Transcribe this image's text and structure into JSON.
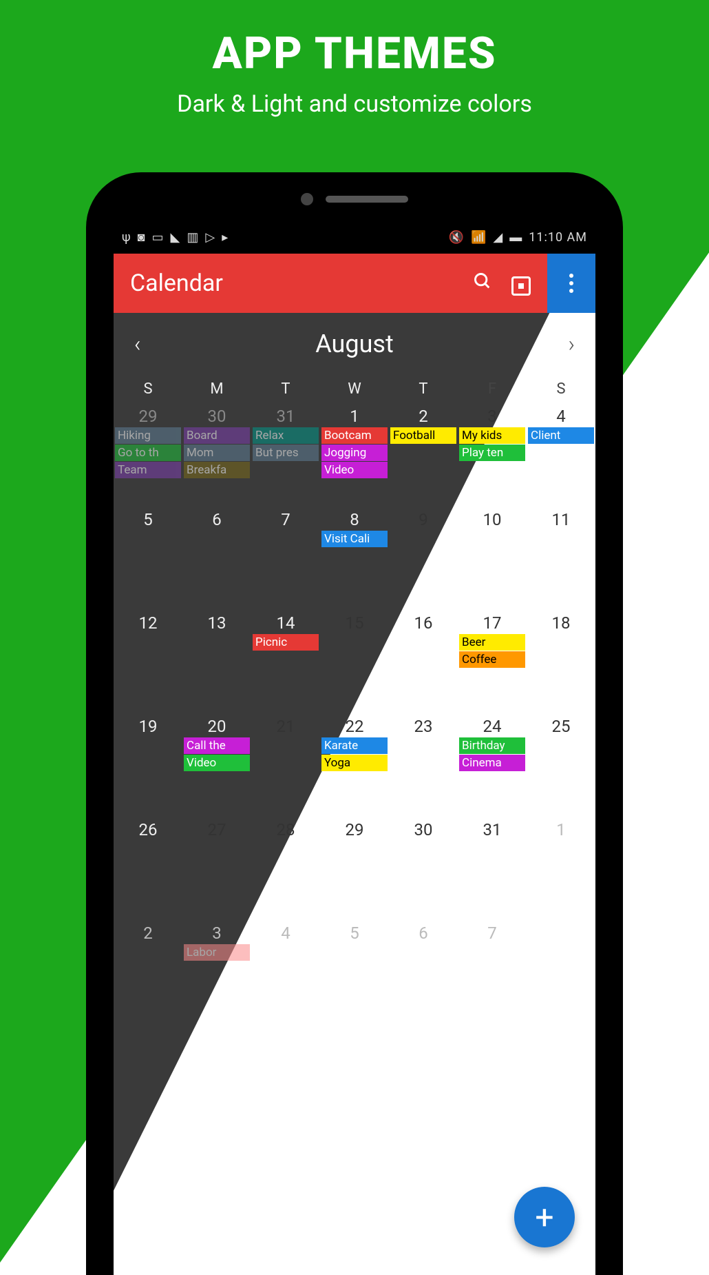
{
  "hero": {
    "title": "APP THEMES",
    "subtitle": "Dark & Light and customize colors"
  },
  "status": {
    "time": "11:10 AM"
  },
  "appbar": {
    "title": "Calendar"
  },
  "month": {
    "label": "August"
  },
  "dow": [
    "S",
    "M",
    "T",
    "W",
    "T",
    "F",
    "S"
  ],
  "colors": {
    "green": "#1ca81c",
    "red": "#e53935",
    "blue": "#1976d2",
    "magenta": "#c61fd6",
    "yellow": "#ffeb00",
    "lime": "#1fbf3a",
    "orange": "#ff9800",
    "teal": "#009688",
    "blue2": "#1e88e5",
    "pink": "#fb8a8a",
    "grayblue": "#5d7d93"
  },
  "weeks": [
    [
      {
        "num": "29",
        "mode": "dark prev",
        "events": [
          {
            "text": "Hiking",
            "bg": "#5d7d93",
            "dim": true
          },
          {
            "text": "Go to th",
            "bg": "#1fbf3a",
            "dim": true
          },
          {
            "text": "Team",
            "bg": "#7d3fae",
            "dim": true
          }
        ]
      },
      {
        "num": "30",
        "mode": "dark prev",
        "events": [
          {
            "text": "Board",
            "bg": "#7d3fae",
            "dim": true
          },
          {
            "text": "Mom",
            "bg": "#5d7d93",
            "dim": true
          },
          {
            "text": "Breakfa",
            "bg": "#7a6a1a",
            "dim": true
          }
        ]
      },
      {
        "num": "31",
        "mode": "dark prev",
        "events": [
          {
            "text": "Relax",
            "bg": "#009688",
            "dim": true
          },
          {
            "text": "But pres",
            "bg": "#5d7d93",
            "dim": true
          }
        ]
      },
      {
        "num": "1",
        "mode": "dark",
        "events": [
          {
            "text": "Bootcam",
            "bg": "#e53935"
          },
          {
            "text": "Jogging",
            "bg": "#c61fd6"
          },
          {
            "text": "Video",
            "bg": "#c61fd6"
          }
        ]
      },
      {
        "num": "2",
        "mode": "dark",
        "events": [
          {
            "text": "Football",
            "bg": "#ffeb00",
            "darktext": true
          }
        ]
      },
      {
        "num": "3",
        "mode": "light",
        "events": [
          {
            "text": "My kids",
            "bg": "#ffeb00",
            "darktext": true
          },
          {
            "text": "Play ten",
            "bg": "#1fbf3a"
          }
        ]
      },
      {
        "num": "4",
        "mode": "light",
        "events": [
          {
            "text": "Client",
            "bg": "#1e88e5"
          }
        ]
      }
    ],
    [
      {
        "num": "5",
        "mode": "dark",
        "events": []
      },
      {
        "num": "6",
        "mode": "dark",
        "events": []
      },
      {
        "num": "7",
        "mode": "dark",
        "events": []
      },
      {
        "num": "8",
        "mode": "dark",
        "events": [
          {
            "text": "Visit Cali",
            "bg": "#1e88e5"
          }
        ]
      },
      {
        "num": "9",
        "mode": "light",
        "events": []
      },
      {
        "num": "10",
        "mode": "light",
        "events": []
      },
      {
        "num": "11",
        "mode": "light",
        "events": []
      }
    ],
    [
      {
        "num": "12",
        "mode": "dark",
        "events": []
      },
      {
        "num": "13",
        "mode": "dark",
        "events": []
      },
      {
        "num": "14",
        "mode": "dark",
        "events": [
          {
            "text": "Picnic",
            "bg": "#e53935"
          }
        ]
      },
      {
        "num": "15",
        "mode": "light",
        "events": []
      },
      {
        "num": "16",
        "mode": "light",
        "events": []
      },
      {
        "num": "17",
        "mode": "light",
        "events": [
          {
            "text": "Beer",
            "bg": "#ffeb00",
            "darktext": true
          },
          {
            "text": "Coffee",
            "bg": "#ff9800",
            "darktext": true
          }
        ]
      },
      {
        "num": "18",
        "mode": "light",
        "events": []
      }
    ],
    [
      {
        "num": "19",
        "mode": "dark",
        "events": []
      },
      {
        "num": "20",
        "mode": "dark",
        "events": [
          {
            "text": "Call the",
            "bg": "#c61fd6"
          },
          {
            "text": "Video",
            "bg": "#1fbf3a"
          }
        ]
      },
      {
        "num": "21",
        "mode": "light",
        "events": []
      },
      {
        "num": "22",
        "mode": "light",
        "events": [
          {
            "text": "Karate",
            "bg": "#1e88e5"
          },
          {
            "text": "Yoga",
            "bg": "#ffeb00",
            "darktext": true
          }
        ]
      },
      {
        "num": "23",
        "mode": "light",
        "events": []
      },
      {
        "num": "24",
        "mode": "light",
        "events": [
          {
            "text": "Birthday",
            "bg": "#1fbf3a"
          },
          {
            "text": "Cinema",
            "bg": "#c61fd6"
          }
        ]
      },
      {
        "num": "25",
        "mode": "light",
        "events": []
      }
    ],
    [
      {
        "num": "26",
        "mode": "dark",
        "events": []
      },
      {
        "num": "27",
        "mode": "light",
        "events": []
      },
      {
        "num": "28",
        "mode": "light",
        "events": []
      },
      {
        "num": "29",
        "mode": "light",
        "events": []
      },
      {
        "num": "30",
        "mode": "light",
        "events": []
      },
      {
        "num": "31",
        "mode": "light",
        "events": []
      },
      {
        "num": "1",
        "mode": "light next",
        "events": []
      }
    ],
    [
      {
        "num": "2",
        "mode": "light next",
        "events": []
      },
      {
        "num": "3",
        "mode": "light next",
        "events": [
          {
            "text": "Labor",
            "bg": "#fb8a8a",
            "dim": true
          }
        ]
      },
      {
        "num": "4",
        "mode": "light next",
        "events": []
      },
      {
        "num": "5",
        "mode": "light next",
        "events": []
      },
      {
        "num": "6",
        "mode": "light next",
        "events": []
      },
      {
        "num": "7",
        "mode": "light next",
        "events": []
      },
      {
        "num": "",
        "mode": "light next",
        "events": []
      }
    ]
  ],
  "fab": {
    "label": "+"
  }
}
